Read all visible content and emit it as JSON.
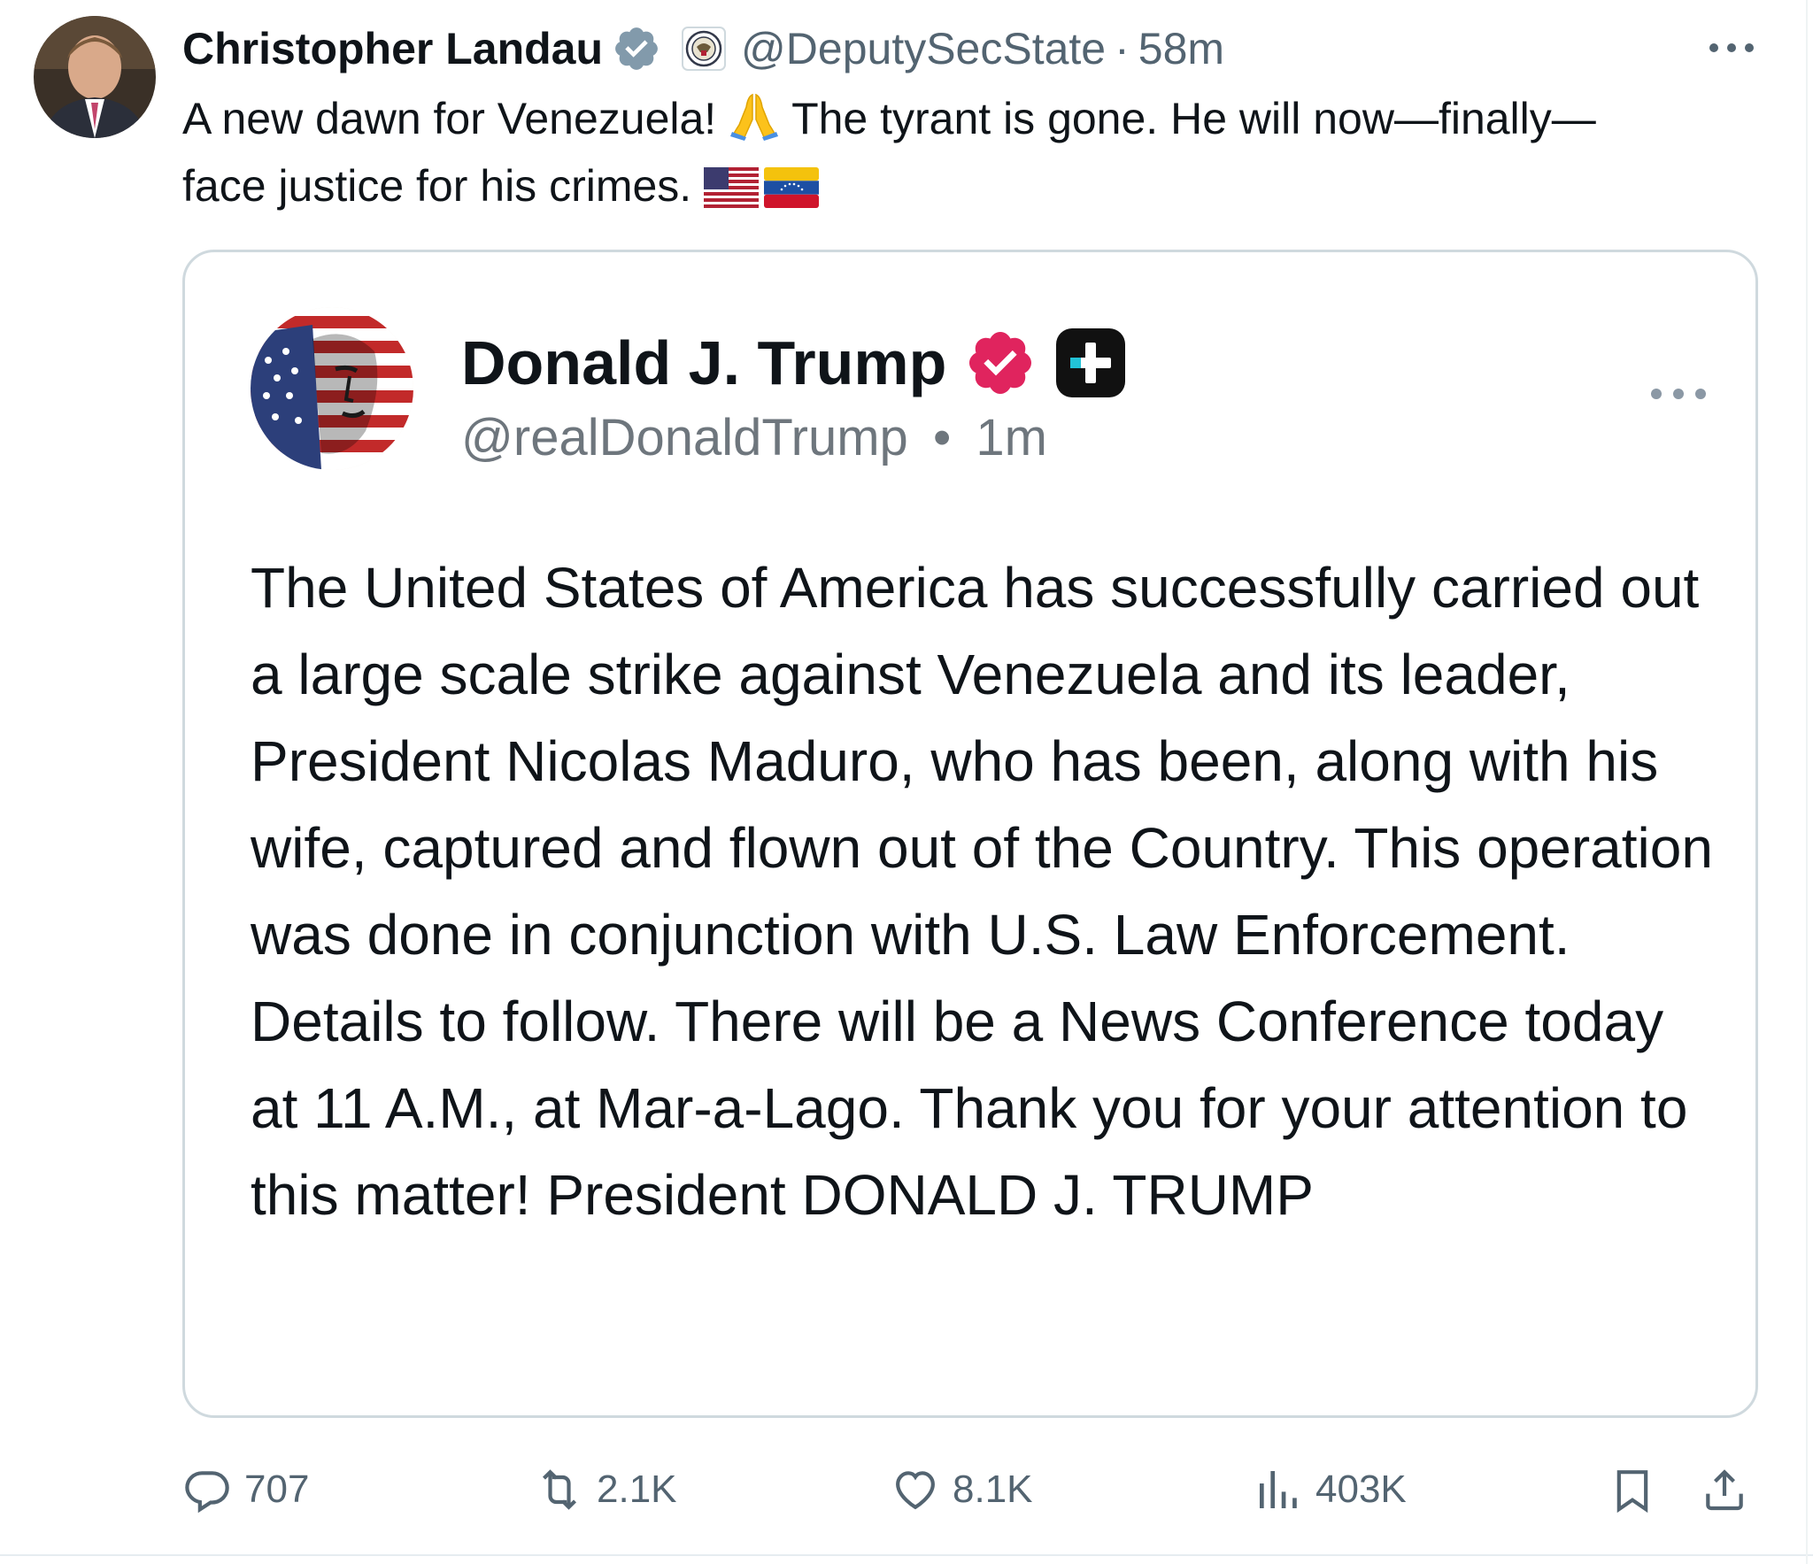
{
  "post": {
    "author": {
      "name": "Christopher Landau",
      "handle": "@DeputySecState",
      "separator": "·",
      "time": "58m"
    },
    "text_part1": "A new dawn for Venezuela! ",
    "text_part2": " The tyrant is gone. He will now—finally—",
    "text_part3": "face justice for his crimes. ",
    "icons": {
      "verified": "verified-badge-icon",
      "affiliation": "state-department-seal-icon",
      "emoji": "folded-hands-emoji",
      "flags": [
        "us-flag-emoji",
        "venezuela-flag-emoji"
      ],
      "more": "more-options-icon"
    }
  },
  "quoted": {
    "name": "Donald J. Trump",
    "handle": "@realDonaldTrump",
    "separator": "•",
    "time": "1m",
    "body": "The United States of America has successfully carried out a large scale strike against Venezuela and its leader, President Nicolas Maduro, who has been, along with his wife, captured and flown out of the Country. This operation was done in conjunction with U.S. Law Enforcement. Details to follow. There will be a News Conference today at 11 A.M., at Mar-a-Lago. Thank you for your attention to this matter! President DONALD J. TRUMP",
    "icons": {
      "verified": "pink-verified-badge-icon",
      "plus": "plus-badge-icon",
      "more": "more-options-icon"
    }
  },
  "actions": {
    "replies": "707",
    "reposts": "2.1K",
    "likes": "8.1K",
    "views": "403K"
  },
  "colors": {
    "text": "#0f1419",
    "muted": "#536471",
    "verified_blue": "#829aab",
    "verified_pink": "#e0245e",
    "border": "#cfd9de"
  }
}
